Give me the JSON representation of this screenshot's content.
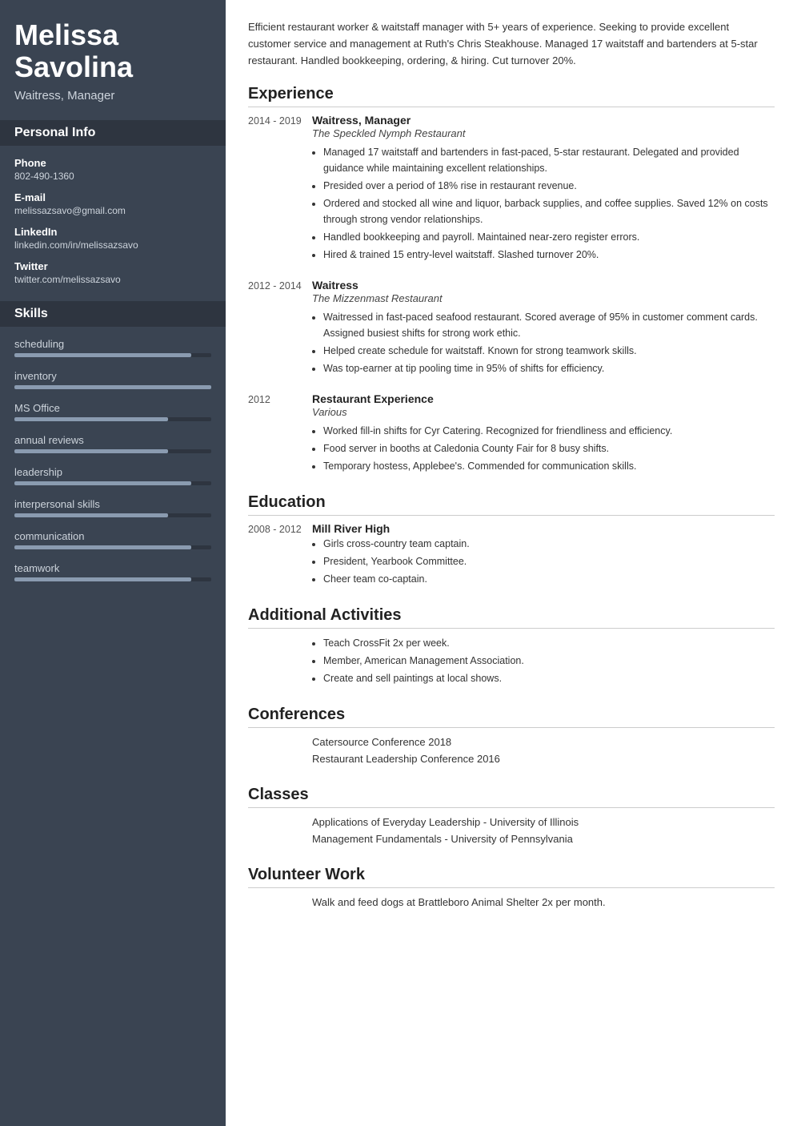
{
  "sidebar": {
    "name": "Melissa Savolina",
    "title": "Waitress, Manager",
    "personal_info_label": "Personal Info",
    "phone_label": "Phone",
    "phone_value": "802-490-1360",
    "email_label": "E-mail",
    "email_value": "melissazsavo@gmail.com",
    "linkedin_label": "LinkedIn",
    "linkedin_value": "linkedin.com/in/melissazsavo",
    "twitter_label": "Twitter",
    "twitter_value": "twitter.com/melissazsavo",
    "skills_label": "Skills",
    "skills": [
      {
        "name": "scheduling",
        "pct": 90
      },
      {
        "name": "inventory",
        "pct": 100
      },
      {
        "name": "MS Office",
        "pct": 78
      },
      {
        "name": "annual reviews",
        "pct": 78
      },
      {
        "name": "leadership",
        "pct": 90
      },
      {
        "name": "interpersonal skills",
        "pct": 78
      },
      {
        "name": "communication",
        "pct": 90
      },
      {
        "name": "teamwork",
        "pct": 90
      }
    ]
  },
  "main": {
    "summary": "Efficient restaurant worker & waitstaff manager with 5+ years of experience. Seeking to provide excellent customer service and management at Ruth's Chris Steakhouse. Managed 17 waitstaff and bartenders at 5-star restaurant. Handled bookkeeping, ordering, & hiring. Cut turnover 20%.",
    "experience_label": "Experience",
    "experience_entries": [
      {
        "date": "2014 - 2019",
        "title": "Waitress, Manager",
        "company": "The Speckled Nymph Restaurant",
        "bullets": [
          "Managed 17 waitstaff and bartenders in fast-paced, 5-star restaurant. Delegated and provided guidance while maintaining excellent relationships.",
          "Presided over a period of 18% rise in restaurant revenue.",
          "Ordered and stocked all wine and liquor, barback supplies, and coffee supplies. Saved 12% on costs through strong vendor relationships.",
          "Handled bookkeeping and payroll. Maintained near-zero register errors.",
          "Hired & trained 15 entry-level waitstaff. Slashed turnover 20%."
        ]
      },
      {
        "date": "2012 - 2014",
        "title": "Waitress",
        "company": "The Mizzenmast Restaurant",
        "bullets": [
          "Waitressed in fast-paced seafood restaurant. Scored average of 95% in customer comment cards. Assigned busiest shifts for strong work ethic.",
          "Helped create schedule for waitstaff. Known for strong teamwork skills.",
          "Was top-earner at tip pooling time in 95% of shifts for efficiency."
        ]
      },
      {
        "date": "2012",
        "title": "Restaurant Experience",
        "company": "Various",
        "bullets": [
          "Worked fill-in shifts for Cyr Catering. Recognized for friendliness and efficiency.",
          "Food server in booths at Caledonia County Fair for 8 busy shifts.",
          "Temporary hostess, Applebee's. Commended for communication skills."
        ]
      }
    ],
    "education_label": "Education",
    "education_entries": [
      {
        "date": "2008 - 2012",
        "title": "Mill River High",
        "bullets": [
          "Girls cross-country team captain.",
          "President, Yearbook Committee.",
          "Cheer team co-captain."
        ]
      }
    ],
    "activities_label": "Additional Activities",
    "activities_bullets": [
      "Teach CrossFit 2x per week.",
      "Member, American Management Association.",
      "Create and sell paintings at local shows."
    ],
    "conferences_label": "Conferences",
    "conferences": [
      "Catersource Conference 2018",
      "Restaurant Leadership Conference 2016"
    ],
    "classes_label": "Classes",
    "classes": [
      "Applications of Everyday Leadership - University of Illinois",
      "Management Fundamentals - University of Pennsylvania"
    ],
    "volunteer_label": "Volunteer Work",
    "volunteer": [
      "Walk and feed dogs at Brattleboro Animal Shelter 2x per month."
    ]
  }
}
